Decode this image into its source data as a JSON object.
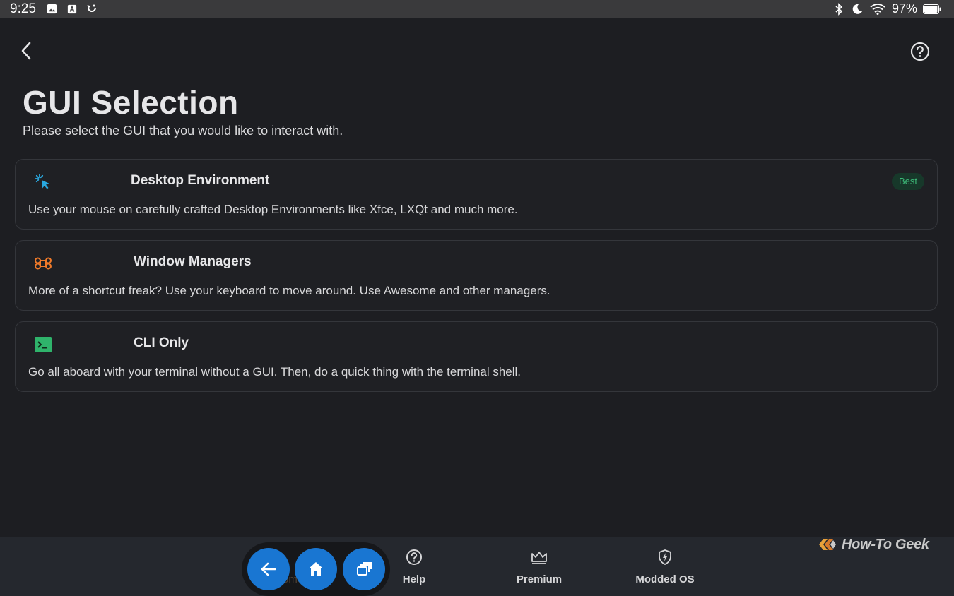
{
  "status_bar": {
    "time": "9:25",
    "left_icons": [
      "image-icon",
      "a-icon",
      "sync-icon"
    ],
    "right_icons": [
      "bluetooth-icon",
      "moon-icon",
      "wifi-icon"
    ],
    "battery_percent": "97%",
    "battery_level": 0.97
  },
  "header": {
    "back_icon": "chevron-left-icon",
    "help_icon": "help-circle-icon"
  },
  "page": {
    "title": "GUI Selection",
    "subtitle": "Please select the GUI that you would like to interact with."
  },
  "options": [
    {
      "icon": "cursor-click-icon",
      "icon_color": "#29a8e0",
      "title": "Desktop Environment",
      "description": "Use your mouse on carefully crafted Desktop Environments like Xfce, LXQt and much more.",
      "badge": "Best"
    },
    {
      "icon": "command-key-icon",
      "icon_color": "#f07a2a",
      "title": "Window Managers",
      "description": "More of a shortcut freak? Use your keyboard to move around. Use Awesome and other managers."
    },
    {
      "icon": "terminal-icon",
      "icon_color": "#2fb36b",
      "title": "CLI Only",
      "description": "Go all aboard with your terminal without a GUI. Then, do a quick thing with the terminal shell."
    }
  ],
  "bottom_nav": {
    "items": [
      {
        "label": "Help",
        "icon": "help-circle-icon"
      },
      {
        "label": "Premium",
        "icon": "crown-icon"
      },
      {
        "label": "Modded OS",
        "icon": "shield-bolt-icon"
      }
    ],
    "hidden_label_fragment": "ome"
  },
  "floating_nav": {
    "buttons": [
      "arrow-left-icon",
      "home-icon",
      "recent-apps-icon"
    ],
    "accent": "#1976d2"
  },
  "watermark": {
    "text": "How-To Geek"
  },
  "colors": {
    "background": "#1d1e22",
    "card_border": "#34363b",
    "badge_bg": "#17382a",
    "badge_text": "#3dbb79"
  }
}
